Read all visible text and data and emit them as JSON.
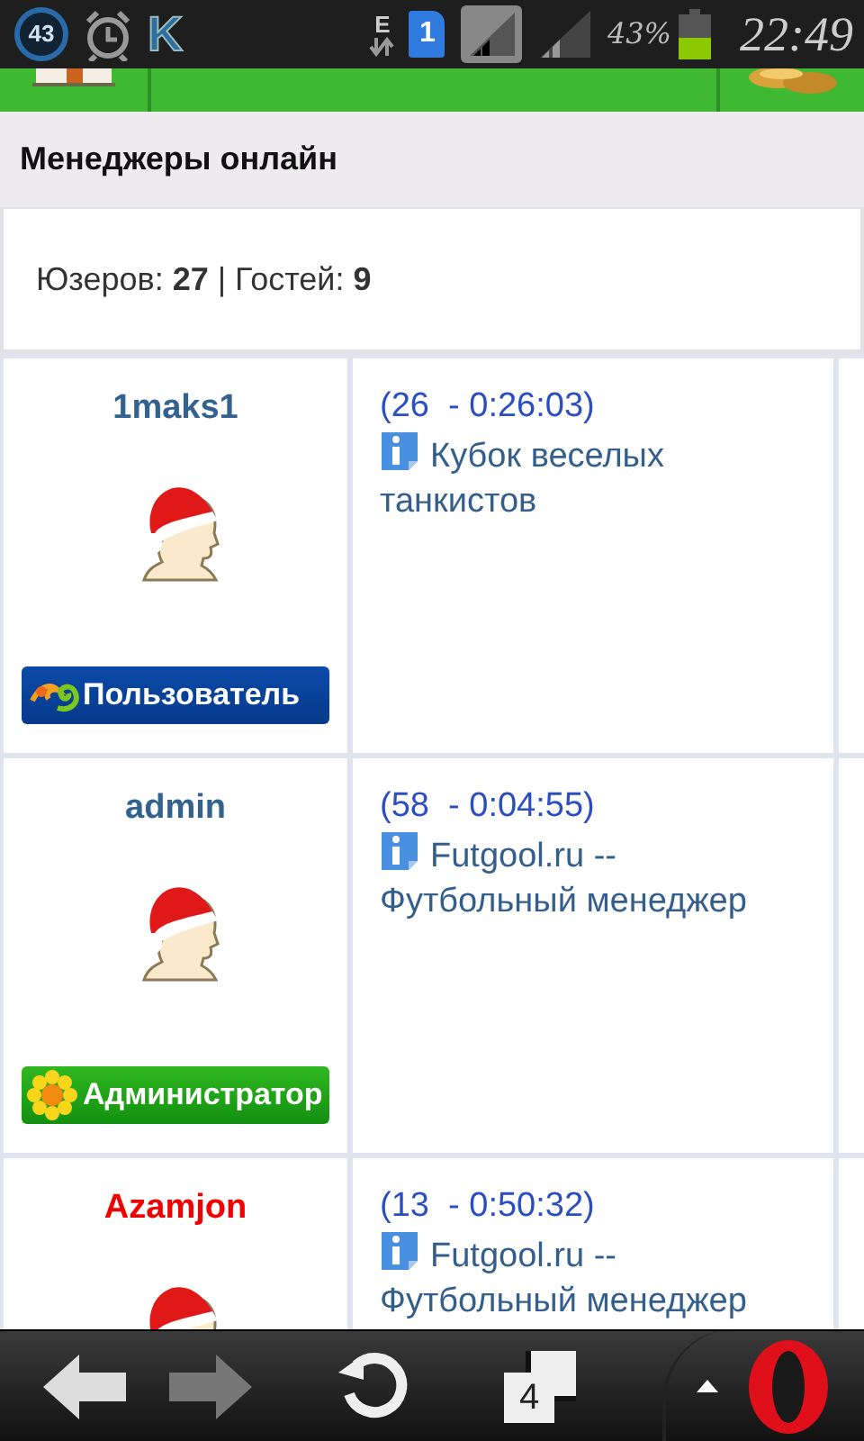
{
  "status_bar": {
    "notification_count": "43",
    "app_letter": "K",
    "network_type": "E",
    "sim_slot": "1",
    "battery_percent": "43%",
    "time": "22:49"
  },
  "page_title": "Менеджеры онлайн",
  "stats": "Юзеров: **27** | Гостей: **9**",
  "managers": [
    {
      "name": "1maks1",
      "color": "#33628f",
      "badge": {
        "kind": "user",
        "label": "Пользователь"
      },
      "online": "(26  - 0:26:03)",
      "team": "Кубок веселых танкистов"
    },
    {
      "name": "admin",
      "color": "#33628f",
      "badge": {
        "kind": "admin",
        "label": "Администратор"
      },
      "online": "(58  - 0:04:55)",
      "team": "Futgool.ru  -- Футбольный менеджер"
    },
    {
      "name": "Azamjon",
      "color": "#f00000",
      "online": "(13  - 0:50:32)",
      "team": "Futgool.ru  -- Футбольный менеджер"
    }
  ],
  "toolbar": {
    "back": {
      "disabled": false
    },
    "forward": {
      "disabled": true
    },
    "tab_count": "4"
  }
}
